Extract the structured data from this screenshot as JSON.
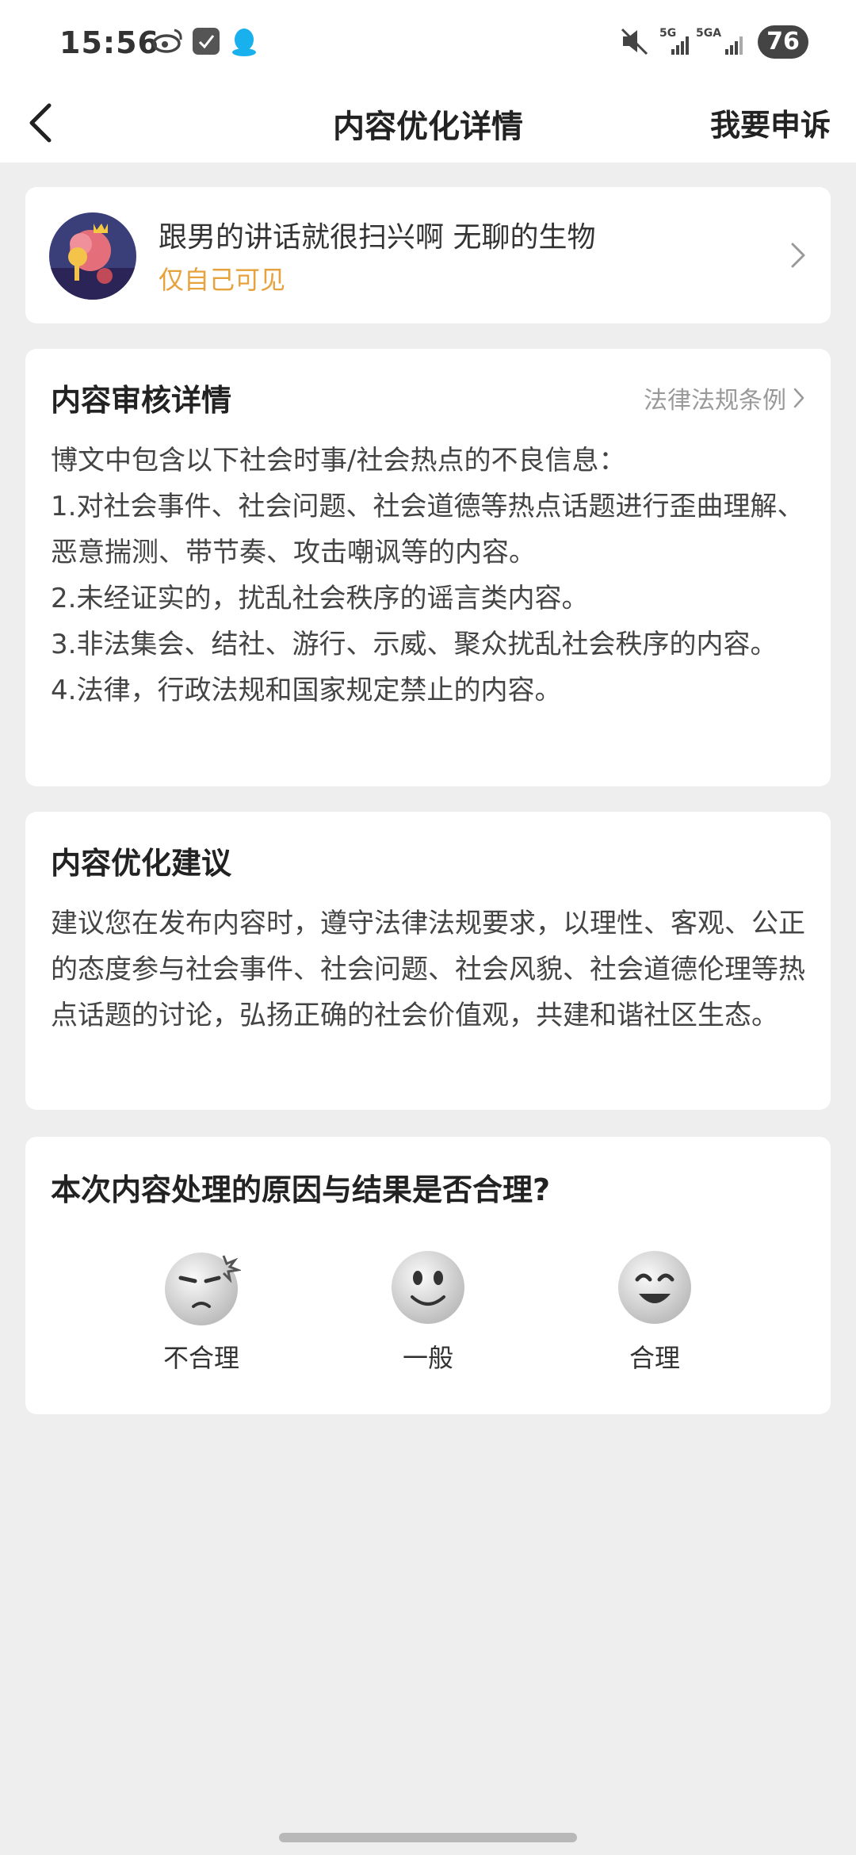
{
  "status_bar": {
    "time": "15:56",
    "battery": "76",
    "net1": "5G",
    "net2": "5GA"
  },
  "nav": {
    "title": "内容优化详情",
    "appeal_label": "我要申诉"
  },
  "post": {
    "text": "跟男的讲话就很扫兴啊 无聊的生物",
    "visibility": "仅自己可见"
  },
  "review": {
    "title": "内容审核详情",
    "law_link": "法律法规条例",
    "lines": [
      "博文中包含以下社会时事/社会热点的不良信息：",
      "1.对社会事件、社会问题、社会道德等热点话题进行歪曲理解、恶意揣测、带节奏、攻击嘲讽等的内容。",
      "2.未经证实的，扰乱社会秩序的谣言类内容。",
      "3.非法集会、结社、游行、示威、聚众扰乱社会秩序的内容。",
      "4.法律，行政法规和国家规定禁止的内容。"
    ]
  },
  "suggestion": {
    "title": "内容优化建议",
    "text": "建议您在发布内容时，遵守法律法规要求，以理性、客观、公正的态度参与社会事件、社会问题、社会风貌、社会道德伦理等热点话题的讨论，弘扬正确的社会价值观，共建和谐社区生态。"
  },
  "feedback": {
    "question": "本次内容处理的原因与结果是否合理?",
    "options": [
      {
        "label": "不合理",
        "icon": "angry-face-icon"
      },
      {
        "label": "一般",
        "icon": "neutral-face-icon"
      },
      {
        "label": "合理",
        "icon": "happy-face-icon"
      }
    ]
  },
  "colors": {
    "accent_orange": "#e6a23c",
    "background": "#eeeeee",
    "card": "#ffffff"
  }
}
